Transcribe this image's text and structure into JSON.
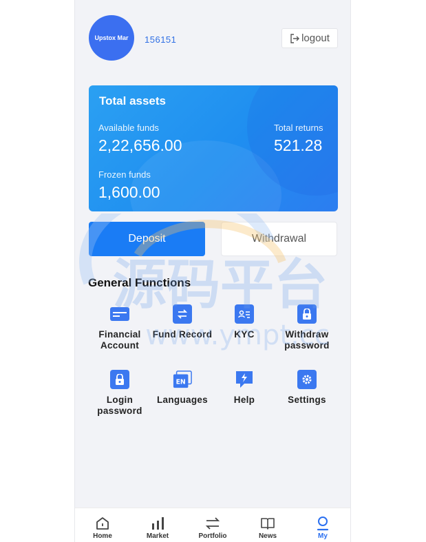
{
  "profile": {
    "avatar_text": "Upstox Mar",
    "user_id": "156151"
  },
  "header": {
    "logout_label": "logout"
  },
  "assets": {
    "title": "Total assets",
    "available_label": "Available funds",
    "available_value": "2,22,656.00",
    "returns_label": "Total returns",
    "returns_value": "521.28",
    "frozen_label": "Frozen funds",
    "frozen_value": "1,600.00"
  },
  "actions": {
    "deposit_label": "Deposit",
    "withdrawal_label": "Withdrawal"
  },
  "functions": {
    "title": "General Functions",
    "items": [
      {
        "label": "Financial Account",
        "icon": "card-icon"
      },
      {
        "label": "Fund Record",
        "icon": "transfer-icon"
      },
      {
        "label": "KYC",
        "icon": "id-card-icon"
      },
      {
        "label": "Withdraw password",
        "icon": "lock-icon"
      },
      {
        "label": "Login password",
        "icon": "lock-icon"
      },
      {
        "label": "Languages",
        "icon": "language-icon"
      },
      {
        "label": "Help",
        "icon": "help-icon"
      },
      {
        "label": "Settings",
        "icon": "settings-icon"
      }
    ]
  },
  "nav": {
    "items": [
      {
        "label": "Home",
        "icon": "home-icon"
      },
      {
        "label": "Market",
        "icon": "chart-bars-icon"
      },
      {
        "label": "Portfolio",
        "icon": "swap-icon"
      },
      {
        "label": "News",
        "icon": "book-icon"
      },
      {
        "label": "My",
        "icon": "user-icon"
      }
    ],
    "active": "My"
  },
  "watermark": {
    "text_cn": "源码平台",
    "text_url": "www.ympt.cc"
  },
  "colors": {
    "accent": "#1a7cf5",
    "card_gradient_start": "#2ba0f2",
    "card_gradient_end": "#2c7df0",
    "background": "#f2f3f7"
  }
}
